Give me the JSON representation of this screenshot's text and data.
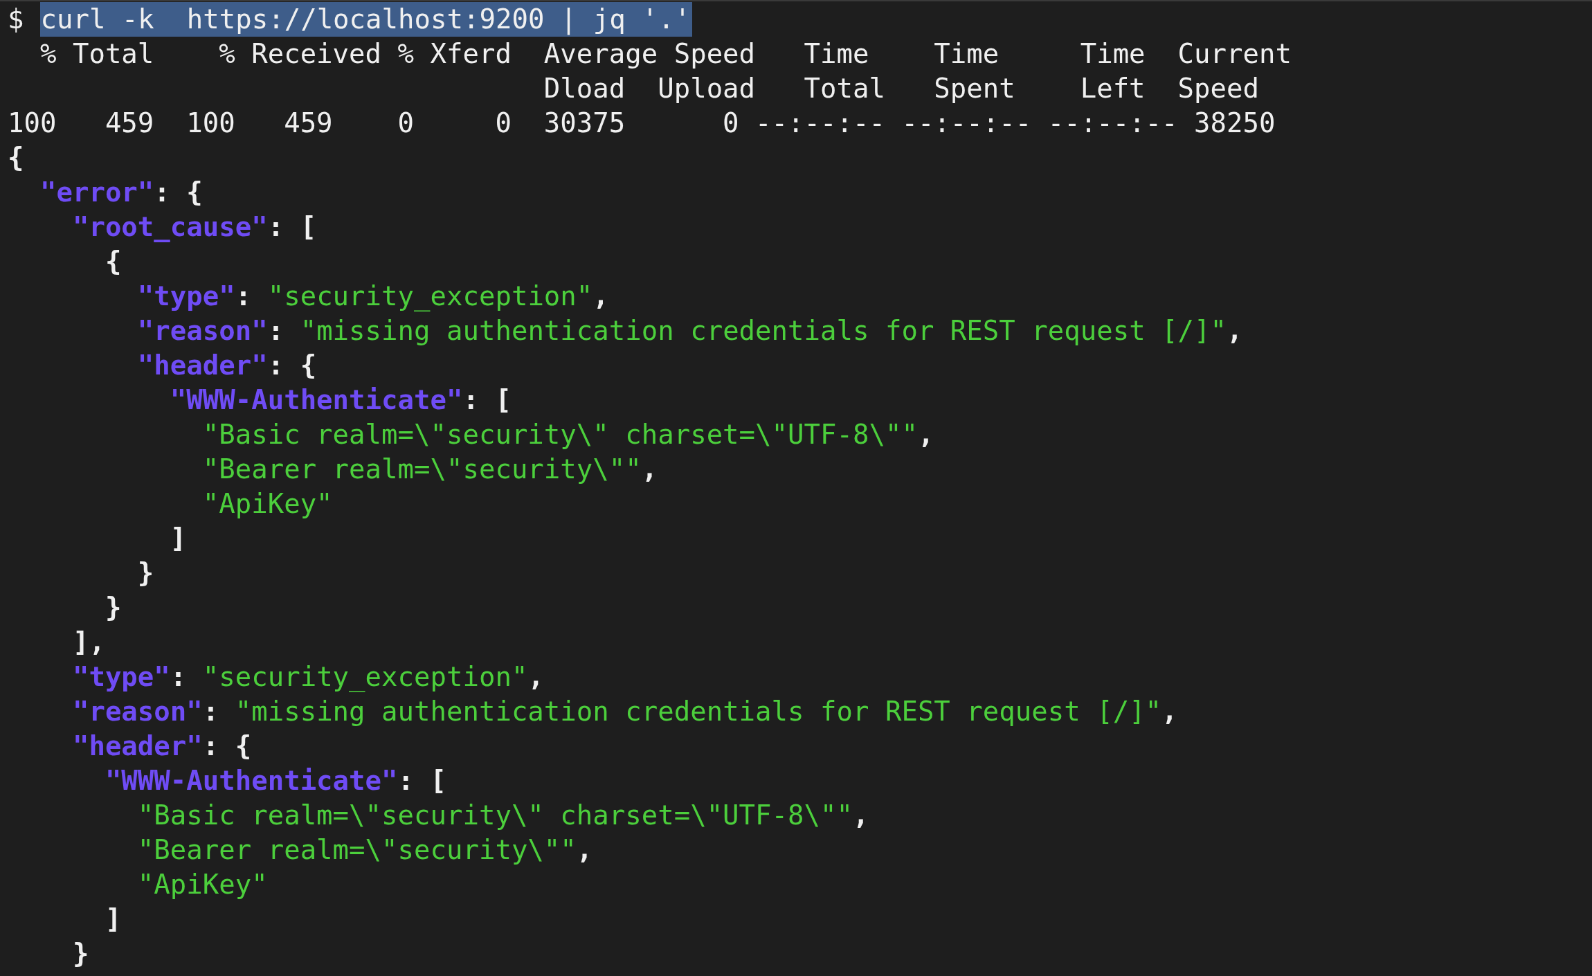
{
  "prompt": {
    "symbol": "$",
    "command": "curl -k  https://localhost:9200 | jq '.'",
    "selected": true
  },
  "progress": [
    "  % Total    % Received % Xferd  Average Speed   Time    Time     Time  Current",
    "                                 Dload  Upload   Total   Spent    Left  Speed",
    "100   459  100   459    0     0  30375      0 --:--:-- --:--:-- --:--:-- 38250"
  ],
  "output": [
    [
      {
        "kind": "punct",
        "text": "{"
      }
    ],
    [
      {
        "kind": "key",
        "text": "  \"error\""
      },
      {
        "kind": "punct",
        "text": ": {"
      }
    ],
    [
      {
        "kind": "key",
        "text": "    \"root_cause\""
      },
      {
        "kind": "punct",
        "text": ": ["
      }
    ],
    [
      {
        "kind": "punct",
        "text": "      {"
      }
    ],
    [
      {
        "kind": "key",
        "text": "        \"type\""
      },
      {
        "kind": "punct",
        "text": ": "
      },
      {
        "kind": "string",
        "text": "\"security_exception\""
      },
      {
        "kind": "punct",
        "text": ","
      }
    ],
    [
      {
        "kind": "key",
        "text": "        \"reason\""
      },
      {
        "kind": "punct",
        "text": ": "
      },
      {
        "kind": "string",
        "text": "\"missing authentication credentials for REST request [/]\""
      },
      {
        "kind": "punct",
        "text": ","
      }
    ],
    [
      {
        "kind": "key",
        "text": "        \"header\""
      },
      {
        "kind": "punct",
        "text": ": {"
      }
    ],
    [
      {
        "kind": "key",
        "text": "          \"WWW-Authenticate\""
      },
      {
        "kind": "punct",
        "text": ": ["
      }
    ],
    [
      {
        "kind": "string",
        "text": "            \"Basic realm=\\\"security\\\" charset=\\\"UTF-8\\\"\""
      },
      {
        "kind": "punct",
        "text": ","
      }
    ],
    [
      {
        "kind": "string",
        "text": "            \"Bearer realm=\\\"security\\\"\""
      },
      {
        "kind": "punct",
        "text": ","
      }
    ],
    [
      {
        "kind": "string",
        "text": "            \"ApiKey\""
      }
    ],
    [
      {
        "kind": "punct",
        "text": "          ]"
      }
    ],
    [
      {
        "kind": "punct",
        "text": "        }"
      }
    ],
    [
      {
        "kind": "punct",
        "text": "      }"
      }
    ],
    [
      {
        "kind": "punct",
        "text": "    ],"
      }
    ],
    [
      {
        "kind": "key",
        "text": "    \"type\""
      },
      {
        "kind": "punct",
        "text": ": "
      },
      {
        "kind": "string",
        "text": "\"security_exception\""
      },
      {
        "kind": "punct",
        "text": ","
      }
    ],
    [
      {
        "kind": "key",
        "text": "    \"reason\""
      },
      {
        "kind": "punct",
        "text": ": "
      },
      {
        "kind": "string",
        "text": "\"missing authentication credentials for REST request [/]\""
      },
      {
        "kind": "punct",
        "text": ","
      }
    ],
    [
      {
        "kind": "key",
        "text": "    \"header\""
      },
      {
        "kind": "punct",
        "text": ": {"
      }
    ],
    [
      {
        "kind": "key",
        "text": "      \"WWW-Authenticate\""
      },
      {
        "kind": "punct",
        "text": ": ["
      }
    ],
    [
      {
        "kind": "string",
        "text": "        \"Basic realm=\\\"security\\\" charset=\\\"UTF-8\\\"\""
      },
      {
        "kind": "punct",
        "text": ","
      }
    ],
    [
      {
        "kind": "string",
        "text": "        \"Bearer realm=\\\"security\\\"\""
      },
      {
        "kind": "punct",
        "text": ","
      }
    ],
    [
      {
        "kind": "string",
        "text": "        \"ApiKey\""
      }
    ],
    [
      {
        "kind": "punct",
        "text": "      ]"
      }
    ],
    [
      {
        "kind": "punct",
        "text": "    }"
      }
    ]
  ]
}
